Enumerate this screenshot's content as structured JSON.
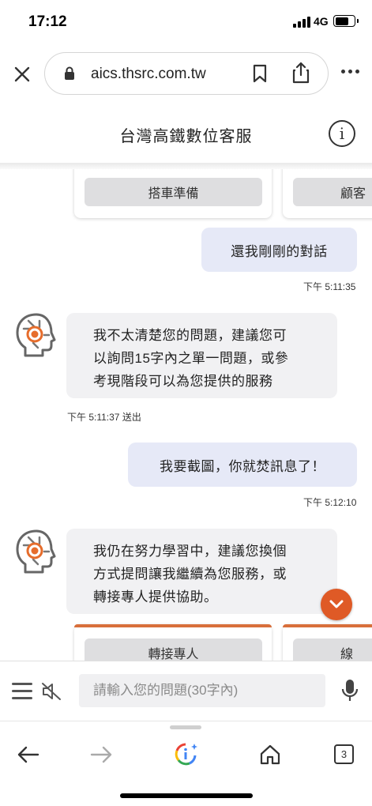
{
  "status_bar": {
    "time": "17:12",
    "network": "4G"
  },
  "browser": {
    "url": "aics.thsrc.com.tw",
    "tab_count": "3"
  },
  "header": {
    "title": "台灣高鐵數位客服",
    "info_label": "i"
  },
  "chat": {
    "top_cards": [
      {
        "button_label": "搭車準備"
      },
      {
        "button_label": "顧客"
      }
    ],
    "messages": [
      {
        "sender": "user",
        "text": "還我剛剛的對話",
        "time": "下午 5:11:35"
      },
      {
        "sender": "bot",
        "lines": [
          "我不太清楚您的問題，建議您可",
          "以詢問15字內之單一問題，或參",
          "考現階段可以為您提供的服務"
        ],
        "time": "下午 5:11:37 送出"
      },
      {
        "sender": "user",
        "text": "我要截圖，你就焚訊息了！",
        "time": "下午 5:12:10"
      },
      {
        "sender": "bot",
        "lines": [
          "我仍在努力學習中，建議您換個",
          "方式提問讓我繼續為您服務，或",
          "轉接專人提供協助。"
        ]
      }
    ],
    "bottom_cards": [
      {
        "button_label": "轉接專人"
      },
      {
        "button_label": "線"
      }
    ]
  },
  "input": {
    "placeholder": "請輸入您的問題(30字內)"
  },
  "colors": {
    "accent_orange": "#df5a26",
    "user_bubble": "#e6e9f7",
    "bot_bubble": "#f1f1f3"
  },
  "icons": [
    "lock-icon",
    "bookmark-icon",
    "share-icon",
    "more-icon",
    "info-icon",
    "bot-avatar-icon",
    "chevron-down-icon",
    "menu-icon",
    "mute-icon",
    "microphone-icon",
    "back-arrow-icon",
    "forward-arrow-icon",
    "google-assistant-icon",
    "home-icon",
    "tabs-icon"
  ]
}
